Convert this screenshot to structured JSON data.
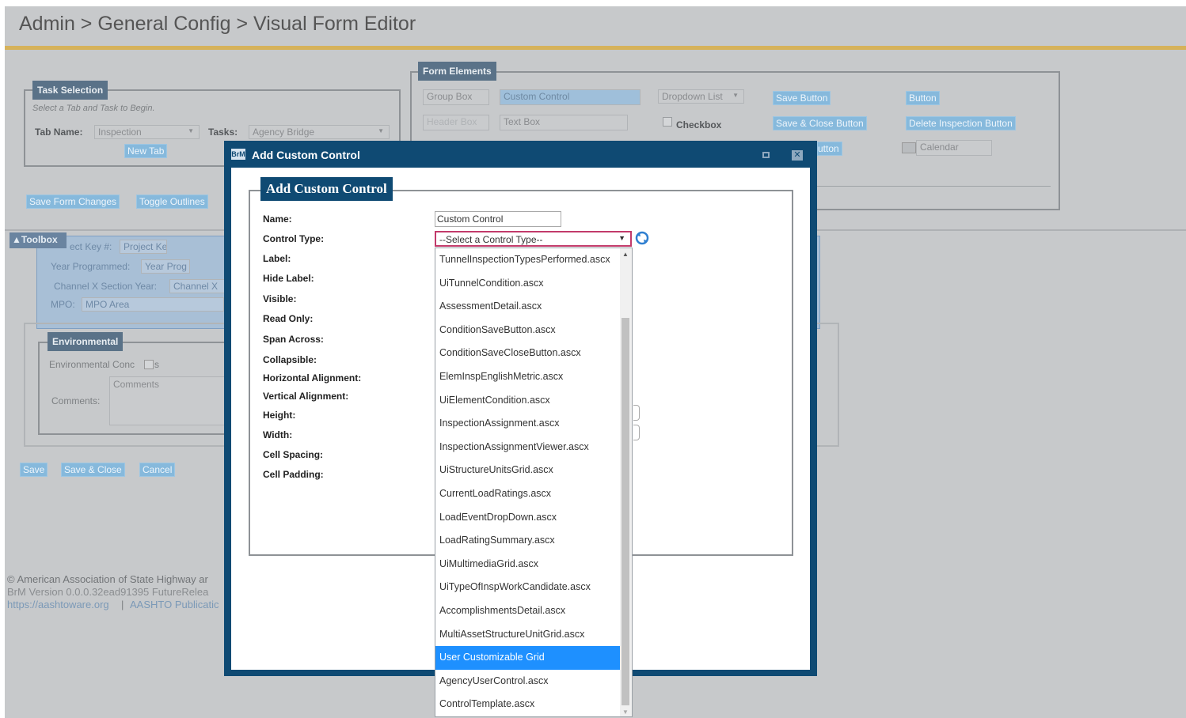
{
  "breadcrumb": "Admin > General Config > Visual Form Editor",
  "task_selection": {
    "legend": "Task Selection",
    "hint": "Select a Tab and Task to Begin.",
    "tab_name_label": "Tab Name:",
    "tab_name_value": "Inspection",
    "tasks_label": "Tasks:",
    "tasks_value": "Agency Bridge",
    "new_tab_button": "New Tab"
  },
  "actions": {
    "save_form_changes": "Save Form Changes",
    "toggle_outlines": "Toggle Outlines"
  },
  "form_elements": {
    "legend": "Form Elements",
    "group_box": "Group Box",
    "custom_control": "Custom Control",
    "dropdown_list": "Dropdown List",
    "save_button": "Save Button",
    "button": "Button",
    "header_box": "Header Box",
    "text_box": "Text Box",
    "checkbox": "Checkbox",
    "save_close_button": "Save & Close Button",
    "delete_inspection_button": "Delete Inspection Button",
    "partial_button": "utton",
    "calendar": "Calendar"
  },
  "toolbox": {
    "label": "▲Toolbox",
    "project_key_label": "ect Key #:",
    "project_key_value": "Project Ke",
    "year_programmed_label": "Year Programmed:",
    "year_programmed_value": "Year Prog",
    "channel_label": "Channel X Section Year:",
    "channel_value": "Channel X",
    "mpo_label": "MPO:",
    "mpo_value": "MPO Area"
  },
  "environmental": {
    "legend": "Environmental",
    "concerns_label": "Environmental Conc",
    "concerns_suffix": "s",
    "comments_label": "Comments:",
    "comments_placeholder": "Comments"
  },
  "bottom_buttons": {
    "save": "Save",
    "save_close": "Save & Close",
    "cancel": "Cancel"
  },
  "footer": {
    "copyright": "© American Association of State Highway ar",
    "version": "BrM Version 0.0.0.32ead91395 FutureRelea",
    "link1": "https://aashtoware.org",
    "separator": "|",
    "link2": "AASHTO Publicatic"
  },
  "modal": {
    "icon_text": "BrM",
    "title": "Add Custom Control",
    "section_title": "Add Custom Control",
    "fields": {
      "name_label": "Name:",
      "name_value": "Custom Control",
      "control_type_label": "Control Type:",
      "control_type_value": "--Select a Control Type--",
      "label_label": "Label:",
      "hide_label_label": "Hide Label:",
      "visible_label": "Visible:",
      "read_only_label": "Read Only:",
      "span_across_label": "Span Across:",
      "collapsible_label": "Collapsible:",
      "horizontal_alignment_label": "Horizontal Alignment:",
      "vertical_alignment_label": "Vertical Alignment:",
      "height_label": "Height:",
      "width_label": "Width:",
      "cell_spacing_label": "Cell Spacing:",
      "cell_padding_label": "Cell Padding:"
    }
  },
  "dropdown_options": [
    "TunnelInspectionTypesPerformed.ascx",
    "UiTunnelCondition.ascx",
    "AssessmentDetail.ascx",
    "ConditionSaveButton.ascx",
    "ConditionSaveCloseButton.ascx",
    "ElemInspEnglishMetric.ascx",
    "UiElementCondition.ascx",
    "InspectionAssignment.ascx",
    "InspectionAssignmentViewer.ascx",
    "UiStructureUnitsGrid.ascx",
    "CurrentLoadRatings.ascx",
    "LoadEventDropDown.ascx",
    "LoadRatingSummary.ascx",
    "UiMultimediaGrid.ascx",
    "UiTypeOfInspWorkCandidate.ascx",
    "AccomplishmentsDetail.ascx",
    "MultiAssetStructureUnitGrid.ascx",
    "User Customizable Grid",
    "AgencyUserControl.ascx",
    "ControlTemplate.ascx"
  ],
  "dropdown_selected_index": 17,
  "colors": {
    "modal_blue": "#0f4a73",
    "overlay_gray": "#c7c9cb",
    "title_rule": "#d6b25a",
    "highlight": "#1e90ff",
    "focus_border": "#c23a6a"
  }
}
